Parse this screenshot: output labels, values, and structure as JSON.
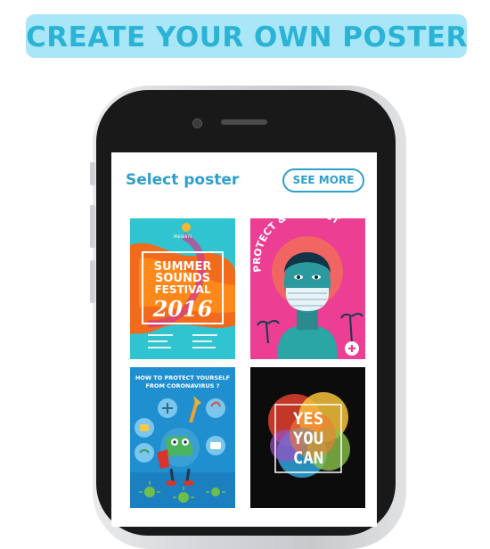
{
  "banner": {
    "title": "CREATE YOUR OWN POSTER"
  },
  "screen": {
    "heading": "Select poster",
    "see_more_label": "SEE MORE"
  },
  "posters": [
    {
      "name": "summer-sounds-festival",
      "header": "PRESENTS",
      "lines": [
        "SUMMER",
        "SOUNDS",
        "FESTIVAL",
        "2016"
      ]
    },
    {
      "name": "protect-and-respect",
      "title": "PROTECT & RESPECT"
    },
    {
      "name": "protect-from-coronavirus",
      "title_line1": "HOW TO PROTECT YOURSELF",
      "title_line2": "FROM CORONAVIRUS ?"
    },
    {
      "name": "yes-you-can",
      "lines": [
        "YES",
        "YOU",
        "CAN"
      ]
    }
  ],
  "colors": {
    "accent": "#2f9fcc",
    "banner_bg": "#a9e7f8",
    "banner_text": "#2bb3d6"
  }
}
